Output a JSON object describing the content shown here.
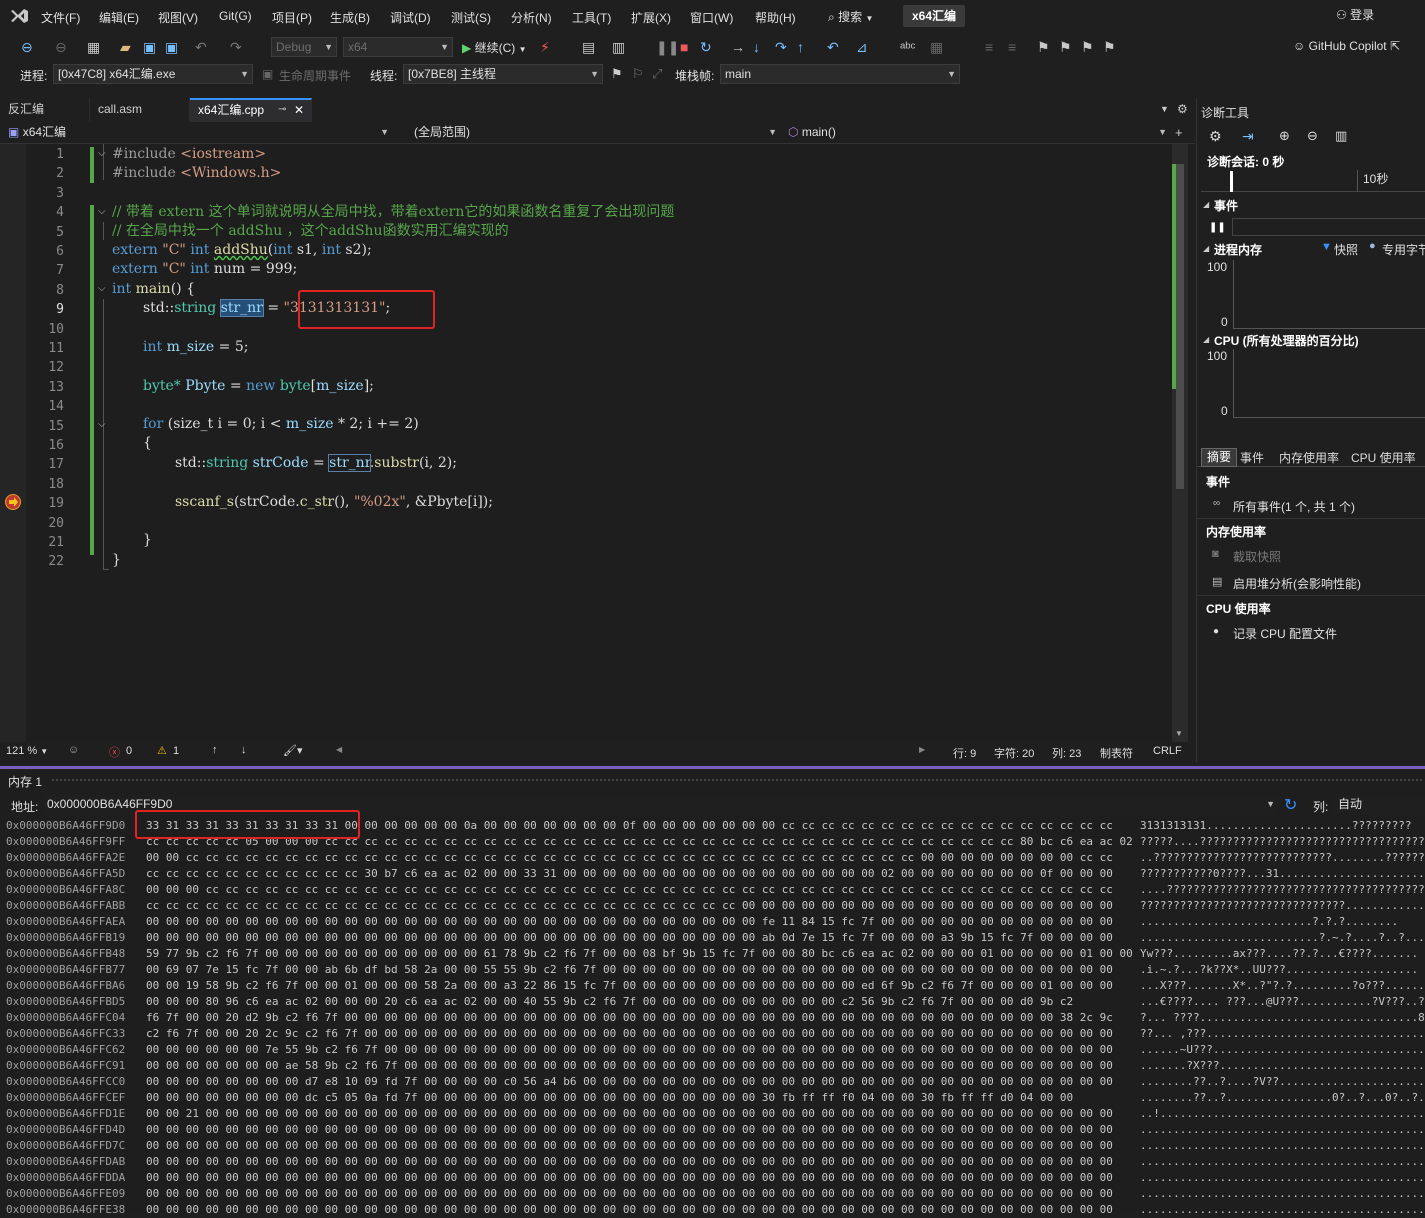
{
  "menu": [
    "文件(F)",
    "编辑(E)",
    "视图(V)",
    "Git(G)",
    "项目(P)",
    "生成(B)",
    "调试(D)",
    "测试(S)",
    "分析(N)",
    "工具(T)",
    "扩展(X)",
    "窗口(W)",
    "帮助(H)"
  ],
  "search_label": "搜索",
  "solution_name": "x64汇编",
  "login_label": "登录",
  "copilot_label": "GitHub Copilot",
  "toolbar": {
    "config": "Debug",
    "platform": "x64",
    "continue_label": "继续(C)"
  },
  "toolbar2": {
    "process_label": "进程:",
    "process_value": "[0x47C8] x64汇编.exe",
    "lifecycle_label": "生命周期事件",
    "thread_label": "线程:",
    "thread_value": "[0x7BE8] 主线程",
    "stackframe_label": "堆栈帧:",
    "stackframe_value": "main"
  },
  "tabs": [
    "反汇编",
    "call.asm",
    "x64汇编.cpp"
  ],
  "nav": {
    "project": "x64汇编",
    "scope": "(全局范围)",
    "member": "main()"
  },
  "line_numbers": [
    "1",
    "2",
    "3",
    "4",
    "5",
    "6",
    "7",
    "8",
    "9",
    "10",
    "11",
    "12",
    "13",
    "14",
    "15",
    "16",
    "17",
    "18",
    "19",
    "20",
    "21",
    "22"
  ],
  "code": {
    "l1_pp": "#include",
    "l1_inc": "<iostream>",
    "l2_pp": "#include",
    "l2_inc": "<Windows.h>",
    "l4": "// 带着 extern 这个单词就说明从全局中找，带着extern它的如果函数名重复了会出现问题",
    "l5": "// 在全局中找一个 addShu ，这个addShu函数实用汇编实现的",
    "l6_kw": "extern",
    "l6_str": "\"C\"",
    "l6_int": "int",
    "l6_fn": "addShu",
    "l6_open": "(",
    "l6_int2": "int",
    "l6_a": "s1,",
    "l6_int3": "int",
    "l6_b": "s2);",
    "l7_kw": "extern",
    "l7_str": "\"C\"",
    "l7_int": "int",
    "l7_rest": "num = 999;",
    "l8_int": "int",
    "l8_fn": "main",
    "l8_rest": "() {",
    "l9_std": "std::",
    "l9_typ": "string",
    "l9_var": "str_nr",
    "l9_eq": "=",
    "l9_str": "\"3131313131\"",
    "l9_end": ";",
    "l11_int": "int",
    "l11_var": "m_size",
    "l11_rest": "= 5;",
    "l13_typ": "byte*",
    "l13_var": "Pbyte",
    "l13_eq": "=",
    "l13_new": "new",
    "l13_typ2": "byte",
    "l13_br": "[",
    "l13_var2": "m_size",
    "l13_end": "];",
    "l15_for": "for",
    "l15_rest": "(size_t i = 0; i <",
    "l15_var": "m_size",
    "l15_end": "* 2; i += 2)",
    "l16": "{",
    "l17_std": "std::",
    "l17_typ": "string",
    "l17_var": "strCode",
    "l17_eq": "=",
    "l17_var2": "str_nr",
    "l17_fn": ".substr",
    "l17_end": "(i, 2);",
    "l19_fn": "sscanf_s",
    "l19_a": "(strCode.",
    "l19_fn2": "c_str",
    "l19_b": "(),",
    "l19_str": "\"%02x\"",
    "l19_c": ", &Pbyte[i]);",
    "l21": "}",
    "l22": "}"
  },
  "status": {
    "zoom": "121 %",
    "errors": "0",
    "warnings": "1",
    "line": "行: 9",
    "char": "字符: 20",
    "col": "列: 23",
    "tabs_mode": "制表符",
    "eol": "CRLF"
  },
  "diag": {
    "title": "诊断工具",
    "session": "诊断会话: 0 秒",
    "timeline_label": "10秒",
    "events_header": "事件",
    "proc_mem_header": "进程内存",
    "snapshot_legend": "快照",
    "private_legend": "专用字节",
    "mem_max": "100",
    "mem_min": "0",
    "cpu_header": "CPU (所有处理器的百分比)",
    "cpu_max": "100",
    "cpu_min": "0",
    "tabs": [
      "摘要",
      "事件",
      "内存使用率",
      "CPU 使用率"
    ],
    "sum_events_header": "事件",
    "all_events": "所有事件(1 个, 共 1 个)",
    "mem_usage_header": "内存使用率",
    "take_snapshot": "截取快照",
    "heap_profile": "启用堆分析(会影响性能)",
    "cpu_usage_header": "CPU 使用率",
    "record_cpu": "记录 CPU 配置文件"
  },
  "memory": {
    "title": "内存 1",
    "address_label": "地址:",
    "address_value": "0x000000B6A46FF9D0",
    "col_label": "列:",
    "col_value": "自动",
    "rows": [
      {
        "addr": "0x000000B6A46FF9D0",
        "hex": "33 31 33 31 33 31 33 31 33 31 00 00 00 00 00 00 0a 00 00 00 00 00 00 00 0f 00 00 00 00 00 00 00 cc cc cc cc cc cc cc cc cc cc cc cc cc cc cc cc cc",
        "asc": "3131313131......................?????????"
      },
      {
        "addr": "0x000000B6A46FF9FF",
        "hex": "cc cc cc cc cc 05 00 00 00 cc cc cc cc cc cc cc cc cc cc cc cc cc cc cc cc cc cc cc cc cc cc cc cc cc cc cc cc cc cc cc cc cc cc cc 80 bc c6 ea ac 02",
        "asc": "?????....????????????????????????????????????"
      },
      {
        "addr": "0x000000B6A46FFA2E",
        "hex": "00 00 cc cc cc cc cc cc cc cc cc cc cc cc cc cc cc cc cc cc cc cc cc cc cc cc cc cc cc cc cc cc cc cc cc cc cc cc cc 00 00 00 00 00 00 00 00 cc cc",
        "asc": "..???????????????????????????........??????"
      },
      {
        "addr": "0x000000B6A46FFA5D",
        "hex": "cc cc cc cc cc cc cc cc cc cc cc 30 b7 c6 ea ac 02 00 00 33 31 00 00 00 00 00 00 00 00 00 00 00 00 00 00 00 00 02 00 00 00 00 00 00 00 0f 00 00 00",
        "asc": "???????????0????...31......................"
      },
      {
        "addr": "0x000000B6A46FFA8C",
        "hex": "00 00 00 cc cc cc cc cc cc cc cc cc cc cc cc cc cc cc cc cc cc cc cc cc cc cc cc cc cc cc cc cc cc cc cc cc cc cc cc cc cc cc cc cc cc cc cc cc cc",
        "asc": "....??????????????????????????????????????????"
      },
      {
        "addr": "0x000000B6A46FFABB",
        "hex": "cc cc cc cc cc cc cc cc cc cc cc cc cc cc cc cc cc cc cc cc cc cc cc cc cc cc cc cc cc cc 00 00 00 00 00 00 00 00 00 00 00 00 00 00 00 00 00 00 00",
        "asc": "???????????????????????????????..............."
      },
      {
        "addr": "0x000000B6A46FFAEA",
        "hex": "00 00 00 00 00 00 00 00 00 00 00 00 00 00 00 00 00 00 00 00 00 00 00 00 00 00 00 00 00 00 00 fe 11 84 15 fc 7f 00 00 00 00 00 00 00 00 00 00 00 00",
        "asc": "..........................?.?.?........"
      },
      {
        "addr": "0x000000B6A46FFB19",
        "hex": "00 00 00 00 00 00 00 00 00 00 00 00 00 00 00 00 00 00 00 00 00 00 00 00 00 00 00 00 00 00 00 ab 0d 7e 15 fc 7f 00 00 00 a3 9b 15 fc 7f 00 00 00 00",
        "asc": "...........................?.~.?....?..?...."
      },
      {
        "addr": "0x000000B6A46FFB48",
        "hex": "59 77 9b c2 f6 7f 00 00 00 00 00 00 00 00 00 00 00 61 78 9b c2 f6 7f 00 00 08 bf 9b 15 fc 7f 00 00 80 bc c6 ea ac 02 00 00 00 01 00 00 00 00 01 00 00",
        "asc": "Yw???.........ax???....??.?...€????......."
      },
      {
        "addr": "0x000000B6A46FFB77",
        "hex": "00 69 07 7e 15 fc 7f 00 00 ab 6b df bd 58 2a 00 00 55 55 9b c2 f6 7f 00 00 00 00 00 00 00 00 00 00 00 00 00 00 00 00 00 00 00 00 00 00 00 00 00 00",
        "asc": ".i.~.?...?k??X*..UU???...................."
      },
      {
        "addr": "0x000000B6A46FFBA6",
        "hex": "00 00 19 58 9b c2 f6 7f 00 00 01 00 00 00 58 2a 00 00 a3 22 86 15 fc 7f 00 00 00 00 00 00 00 00 00 00 00 00 ed 6f 9b c2 f6 7f 00 00 00 01 00 00 00",
        "asc": "...X???.......X*..?\"?.?.........?o???......"
      },
      {
        "addr": "0x000000B6A46FFBD5",
        "hex": "00 00 00 80 96 c6 ea ac 02 00 00 00 20 c6 ea ac 02 00 00 40 55 9b c2 f6 7f 00 00 00 00 00 00 00 00 00 00 c2 56 9b c2 f6 7f 00 00 00 d0 9b c2",
        "asc": "...€????.... ???...@U???...........?V???..?"
      },
      {
        "addr": "0x000000B6A46FFC04",
        "hex": "f6 7f 00 00 20 d2 9b c2 f6 7f 00 00 00 00 00 00 00 00 00 00 00 00 00 00 00 00 00 00 00 00 00 00 00 00 00 00 00 00 00 00 00 00 00 00 00 00 38 2c 9c",
        "asc": "?... ????.................................8,?"
      },
      {
        "addr": "0x000000B6A46FFC33",
        "hex": "c2 f6 7f 00 00 20 2c 9c c2 f6 7f 00 00 00 00 00 00 00 00 00 00 00 00 00 00 00 00 00 00 00 00 00 00 00 00 00 00 00 00 00 00 00 00 00 00 00 00 00 00",
        "asc": "??... ,???..................................."
      },
      {
        "addr": "0x000000B6A46FFC62",
        "hex": "00 00 00 00 00 00 7e 55 9b c2 f6 7f 00 00 00 00 00 00 00 00 00 00 00 00 00 00 00 00 00 00 00 00 00 00 00 00 00 00 00 00 00 00 00 00 00 00 00 00 00",
        "asc": "......~U???...................................."
      },
      {
        "addr": "0x000000B6A46FFC91",
        "hex": "00 00 00 00 00 00 00 ae 58 9b c2 f6 7f 00 00 00 00 00 00 00 00 00 00 00 00 00 00 00 00 00 00 00 00 00 00 00 00 00 00 00 00 00 00 00 00 00 00 00 00",
        "asc": ".......?X???......................................"
      },
      {
        "addr": "0x000000B6A46FFCC0",
        "hex": "00 00 00 00 00 00 00 00 d7 e8 10 09 fd 7f 00 00 00 00 c0 56 a4 b6 00 00 00 00 00 00 00 00 00 00 00 00 00 00 00 00 00 00 00 00 00 00 00 00 00 00 00",
        "asc": "........??..?....?V??............................."
      },
      {
        "addr": "0x000000B6A46FFCEF",
        "hex": "00 00 00 00 00 00 00 00 dc c5 05 0a fd 7f 00 00 00 00 00 00 00 00 00 00 00 00 00 00 00 00 00 30 fb ff ff f0 04 00 00 30 fb ff ff d0 04 00 00",
        "asc": "........??..?................0?..?...0?..?..."
      },
      {
        "addr": "0x000000B6A46FFD1E",
        "hex": "00 00 21 00 00 00 00 00 00 00 00 00 00 00 00 00 00 00 00 00 00 00 00 00 00 00 00 00 00 00 00 00 00 00 00 00 00 00 00 00 00 00 00 00 00 00 00 00 00",
        "asc": "..!.............................................."
      },
      {
        "addr": "0x000000B6A46FFD4D",
        "hex": "00 00 00 00 00 00 00 00 00 00 00 00 00 00 00 00 00 00 00 00 00 00 00 00 00 00 00 00 00 00 00 00 00 00 00 00 00 00 00 00 00 00 00 00 00 00 00 00 00",
        "asc": "................................................."
      },
      {
        "addr": "0x000000B6A46FFD7C",
        "hex": "00 00 00 00 00 00 00 00 00 00 00 00 00 00 00 00 00 00 00 00 00 00 00 00 00 00 00 00 00 00 00 00 00 00 00 00 00 00 00 00 00 00 00 00 00 00 00 00 00",
        "asc": "................................................."
      },
      {
        "addr": "0x000000B6A46FFDAB",
        "hex": "00 00 00 00 00 00 00 00 00 00 00 00 00 00 00 00 00 00 00 00 00 00 00 00 00 00 00 00 00 00 00 00 00 00 00 00 00 00 00 00 00 00 00 00 00 00 00 00 00",
        "asc": "................................................."
      },
      {
        "addr": "0x000000B6A46FFDDA",
        "hex": "00 00 00 00 00 00 00 00 00 00 00 00 00 00 00 00 00 00 00 00 00 00 00 00 00 00 00 00 00 00 00 00 00 00 00 00 00 00 00 00 00 00 00 00 00 00 00 00 00",
        "asc": "................................................."
      },
      {
        "addr": "0x000000B6A46FFE09",
        "hex": "00 00 00 00 00 00 00 00 00 00 00 00 00 00 00 00 00 00 00 00 00 00 00 00 00 00 00 00 00 00 00 00 00 00 00 00 00 00 00 00 00 00 00 00 00 00 00 00 00",
        "asc": "................................................."
      },
      {
        "addr": "0x000000B6A46FFE38",
        "hex": "00 00 00 00 00 00 00 00 00 00 00 00 00 00 00 00 00 00 00 00 00 00 00 00 00 00 00 00 00 00 00 00 00 00 00 00 00 00 00 00 00 00 00 00 00 00 00 00 00",
        "asc": "................................................."
      }
    ]
  },
  "colors": {
    "accent": "#3794ff",
    "highlight": "#e02424",
    "split": "#7a5fbf"
  }
}
